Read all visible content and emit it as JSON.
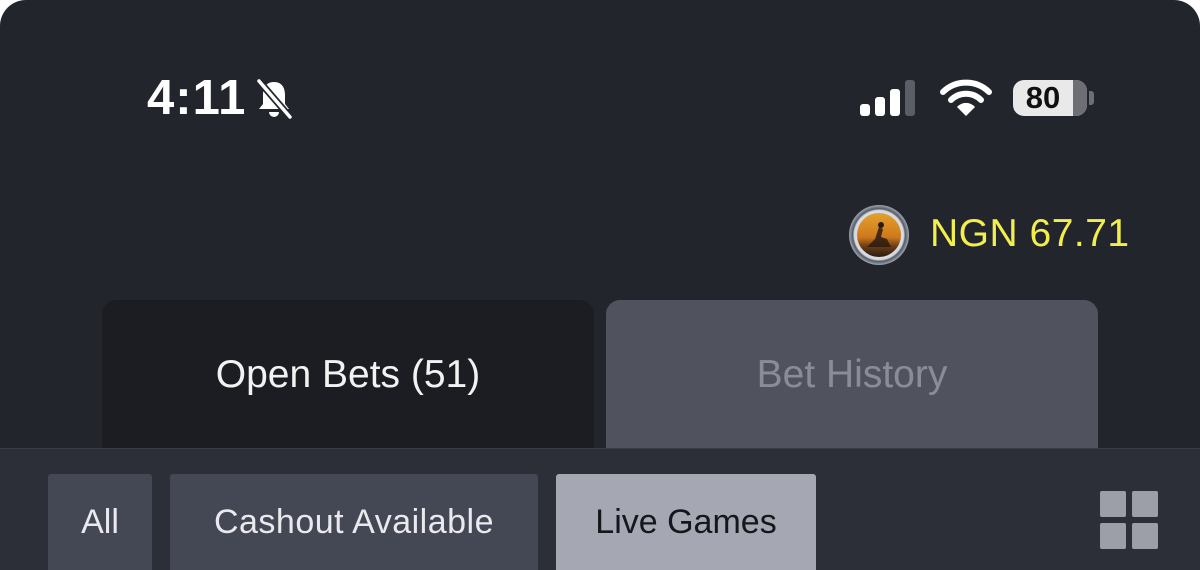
{
  "status_bar": {
    "time": "4:11",
    "battery_level": "80",
    "icons": [
      "bell-slash-icon",
      "cellular-signal-icon",
      "wifi-icon",
      "battery-icon"
    ]
  },
  "account": {
    "balance": "NGN 67.71",
    "balance_color": "#f3ee4b",
    "avatar_icon": "user-avatar"
  },
  "tabs": [
    {
      "label": "Open Bets (51)",
      "active": true
    },
    {
      "label": "Bet History",
      "active": false
    }
  ],
  "filters": [
    {
      "label": "All",
      "selected": false
    },
    {
      "label": "Cashout Available",
      "selected": false
    },
    {
      "label": "Live Games",
      "selected": true
    }
  ],
  "toolbar": {
    "layout_icon": "grid-view-icon"
  },
  "colors": {
    "background": "#22252c",
    "active_tab": "#1b1d22",
    "inactive_tab": "#50535e",
    "chip": "#444754",
    "chip_selected": "#a5a7b2"
  }
}
